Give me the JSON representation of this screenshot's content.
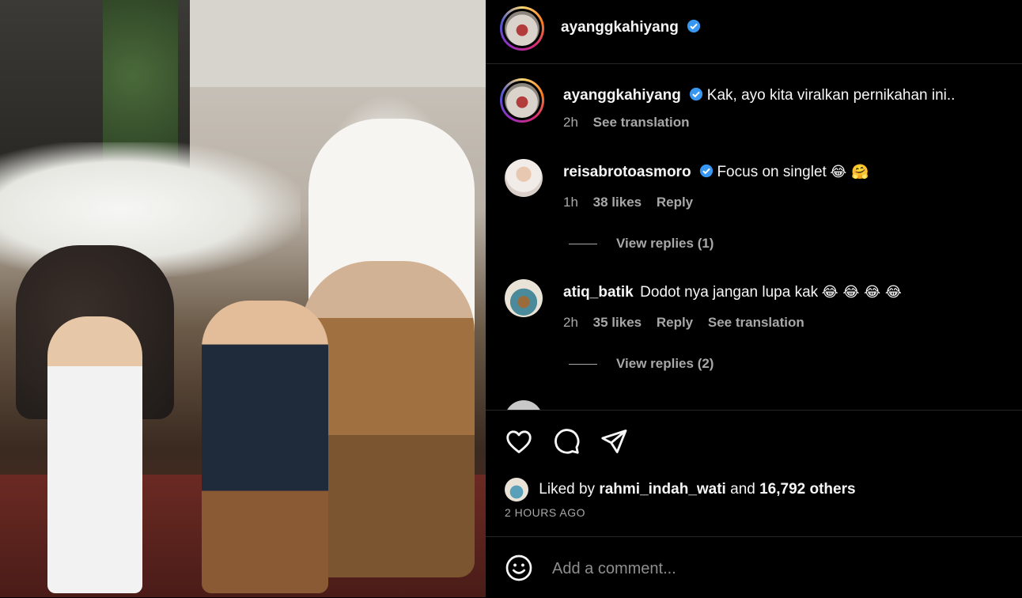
{
  "post": {
    "photo_alt": "wedding-photo"
  },
  "header": {
    "username": "ayanggkahiyang",
    "verified": true
  },
  "caption": {
    "username": "ayanggkahiyang",
    "text": "Kak, ayo kita viralkan pernikahan ini..",
    "time": "2h",
    "translate": "See translation"
  },
  "comments": [
    {
      "username": "reisabrotoasmoro",
      "verified": true,
      "text": "Focus on singlet",
      "emoji": "😂 🤗",
      "time": "1h",
      "likes": "38 likes",
      "reply": "Reply",
      "view_replies": "View replies (1)"
    },
    {
      "username": "atiq_batik",
      "verified": false,
      "text": "Dodot nya jangan lupa kak",
      "emoji": "😂 😂 😂 😂",
      "time": "2h",
      "likes": "35 likes",
      "reply": "Reply",
      "translate": "See translation",
      "view_replies": "View replies (2)"
    }
  ],
  "likes": {
    "prefix": "Liked by",
    "user": "rahmi_indah_wati",
    "middle": "and",
    "others": "16,792 others"
  },
  "timestamp": "2 HOURS AGO",
  "comment_box": {
    "placeholder": "Add a comment..."
  },
  "colors": {
    "background": "#000000",
    "text": "#f5f5f5",
    "muted": "#a8a8a8",
    "verified": "#3897f0"
  }
}
